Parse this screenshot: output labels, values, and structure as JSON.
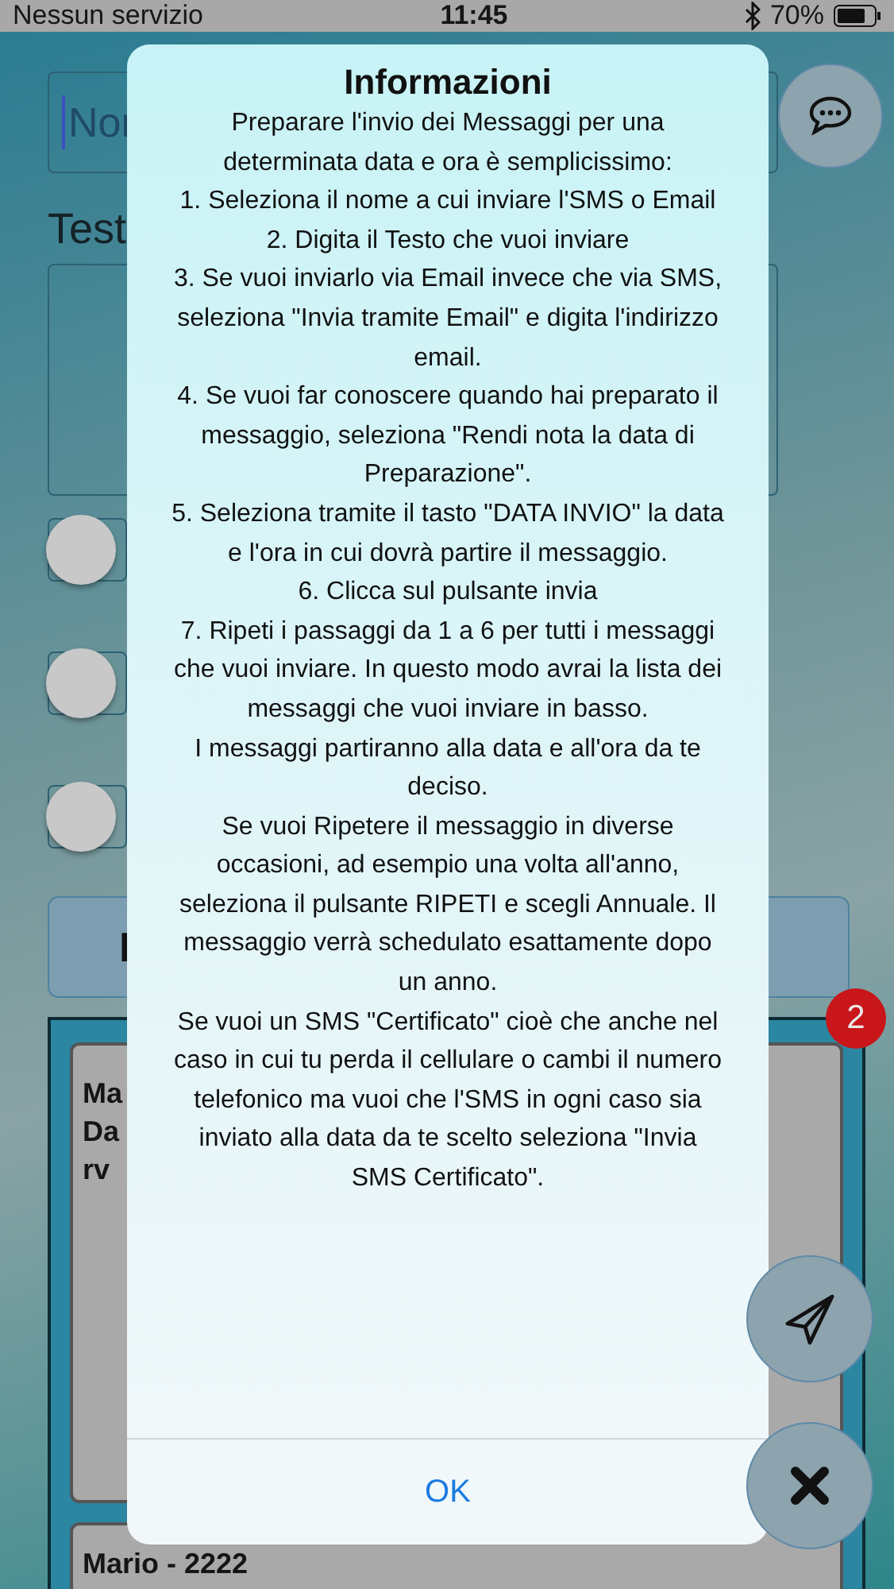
{
  "status_bar": {
    "carrier": "Nessun servizio",
    "time": "11:45",
    "battery": "70%"
  },
  "background": {
    "name_field": {
      "placeholder": "Nor"
    },
    "text_label": "Test",
    "toggles": [
      {
        "on": false
      },
      {
        "on": false
      },
      {
        "on": false
      }
    ],
    "button_label": "I",
    "badge": "2",
    "messages": [
      {
        "lines": [
          "Ma",
          "Da",
          "rv"
        ]
      },
      {
        "lines": [
          "Mario - 2222"
        ]
      }
    ]
  },
  "dialog": {
    "title": "Informazioni",
    "paragraphs": [
      "Preparare l'invio dei Messaggi per una determinata data e ora è semplicissimo:",
      "1. Seleziona il nome a cui inviare l'SMS o Email",
      "2. Digita il Testo che vuoi inviare",
      "3. Se vuoi inviarlo via Email invece che via SMS, seleziona \"Invia tramite Email\" e digita l'indirizzo email.",
      "4. Se vuoi far conoscere quando hai preparato il messaggio, seleziona \"Rendi nota la data di Preparazione\".",
      "5. Seleziona tramite il tasto \"DATA INVIO\" la data e l'ora in cui dovrà partire il messaggio.",
      "6. Clicca sul pulsante invia",
      "7. Ripeti i passaggi da 1 a 6 per tutti i messaggi che vuoi inviare. In questo modo avrai la lista dei messaggi che vuoi inviare in basso.",
      "I messaggi partiranno alla data e all'ora da te deciso.",
      "Se vuoi Ripetere il messaggio in diverse occasioni, ad esempio una volta all'anno, seleziona il pulsante RIPETI e scegli Annuale. Il messaggio verrà schedulato esattamente dopo un anno.",
      "Se vuoi un SMS \"Certificato\" cioè che anche nel caso in cui tu perda il cellulare o cambi il numero telefonico ma vuoi che l'SMS in ogni caso sia inviato alla data da te scelto seleziona \"Invia SMS Certificato\"."
    ],
    "button": "OK"
  }
}
